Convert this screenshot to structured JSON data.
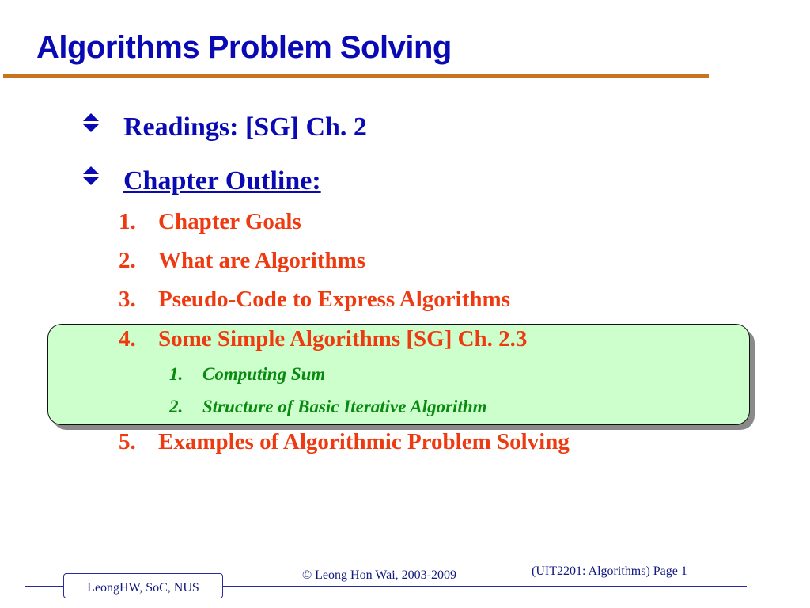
{
  "slide": {
    "title": "Algorithms Problem Solving",
    "bullets": [
      {
        "icon": "double-triangle-bullet-icon",
        "label": "Readings:  [SG] Ch. 2"
      },
      {
        "icon": "double-triangle-bullet-icon",
        "label": "Chapter Outline:"
      }
    ],
    "outline": [
      {
        "num": "1.",
        "label": "Chapter Goals"
      },
      {
        "num": "2.",
        "label": "What are Algorithms"
      },
      {
        "num": "3.",
        "label": "Pseudo-Code to Express Algorithms"
      },
      {
        "num": "4.",
        "label": "Some Simple Algorithms [SG] Ch. 2.3",
        "sub": [
          {
            "num": "1.",
            "label": "Computing Sum"
          },
          {
            "num": "2.",
            "label": "Structure of Basic Iterative Algorithm"
          }
        ]
      },
      {
        "num": "5.",
        "label": "Examples of Algorithmic Problem Solving"
      }
    ],
    "colors": {
      "title": "#0a0ab4",
      "rule": "#c8741e",
      "items": "#ee3a10",
      "subitems": "#0a8a10",
      "highlight": "#ccffcc"
    }
  },
  "footer": {
    "author_box": "LeongHW, SoC, NUS",
    "copyright": "© Leong Hon Wai, 2003-2009",
    "page_label": "(UIT2201: Algorithms) Page 1"
  }
}
